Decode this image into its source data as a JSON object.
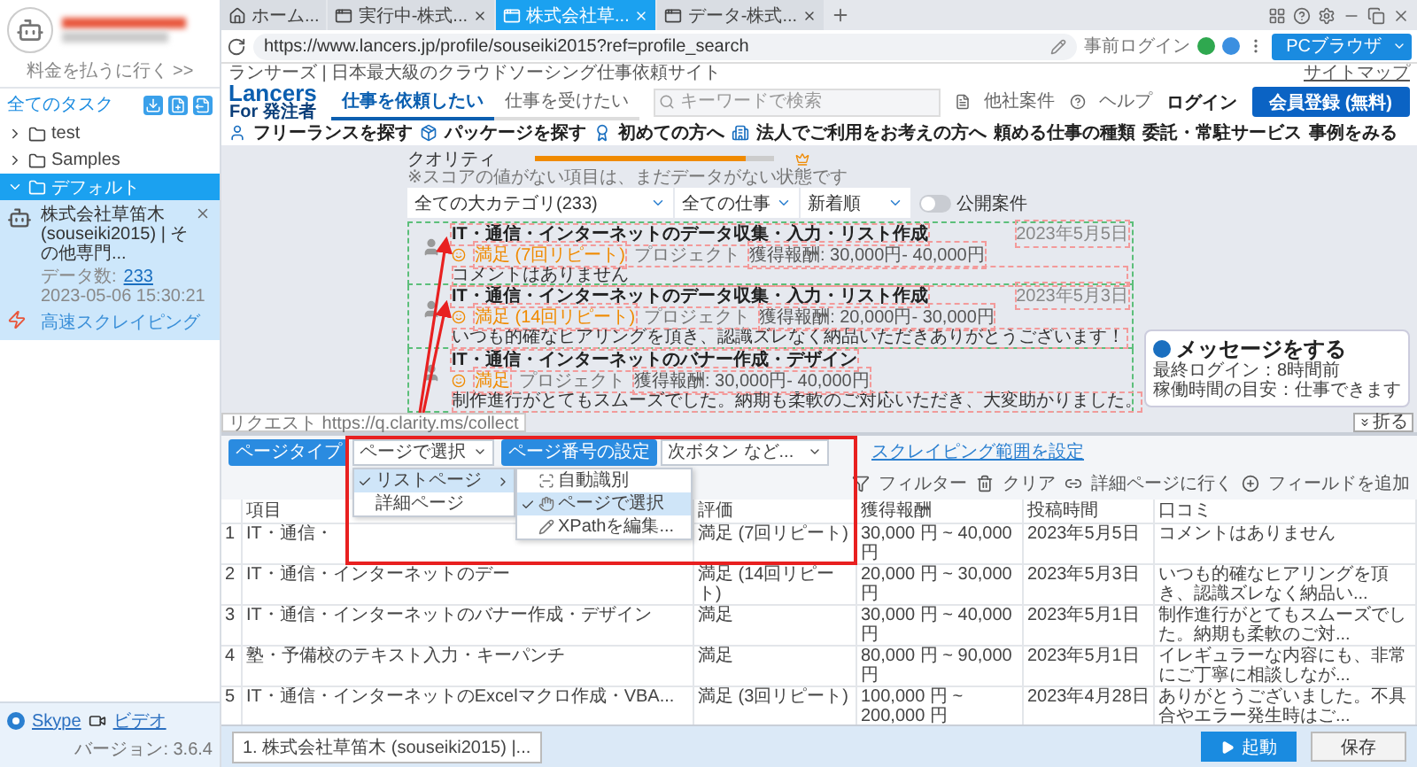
{
  "sidebar": {
    "account_link": "料金を払うに行く >>",
    "header": "全てのタスク",
    "folders": [
      {
        "label": "test",
        "expanded": false,
        "selected": false
      },
      {
        "label": "Samples",
        "expanded": false,
        "selected": false
      },
      {
        "label": "デフォルト",
        "expanded": true,
        "selected": true,
        "tasks": [
          {
            "title": "株式会社草笛木 (souseiki2015) | その他専門...",
            "data_label": "データ数:",
            "count": "233",
            "time": "2023-05-06 15:30:21",
            "mode": "高速スクレイピング"
          }
        ]
      }
    ],
    "footer": {
      "links": [
        "Skype",
        "ビデオ"
      ],
      "version": "バージョン: 3.6.4"
    }
  },
  "browser": {
    "tabs": [
      {
        "label": "ホーム...",
        "selected": false,
        "kind": "home"
      },
      {
        "label": "実行中-株式...",
        "selected": false,
        "kind": "page"
      },
      {
        "label": "株式会社草...",
        "selected": true,
        "kind": "page"
      },
      {
        "label": "データ-株式...",
        "selected": false,
        "kind": "page"
      }
    ],
    "url": "https://www.lancers.jp/profile/souseiki2015?ref=profile_search",
    "login": "事前ログイン",
    "mode_button": "PCブラウザ"
  },
  "page": {
    "tagline": "ランサーズ | 日本最大級のクラウドソーシング仕事依頼サイト",
    "sitemap": "サイトマップ",
    "logo": "Lancers",
    "logo_sub": "For 発注者",
    "tabs": [
      {
        "label": "仕事を依頼したい",
        "selected": true
      },
      {
        "label": "仕事を受けたい",
        "selected": false
      }
    ],
    "search": {
      "placeholder": "キーワードで検索"
    },
    "icon_links": [
      "他社案件",
      "ヘルプ"
    ],
    "login": "ログイン",
    "signup": "会員登録 (無料)",
    "nav": [
      "フリーランスを探す",
      "パッケージを探す",
      "初めての方へ",
      "法人でご利用をお考えの方へ",
      "頼める仕事の種類",
      "委託・常駐サービス",
      "事例をみる"
    ],
    "quality": {
      "label": "クオリティ",
      "level": 0.88
    },
    "note": "※スコアの値がない項目は、まだデータがない状態です",
    "filters": [
      "全ての大カテゴリ(233)",
      "全ての仕事",
      "新着順"
    ],
    "public_toggle": {
      "label": "公開案件",
      "on": false
    },
    "cards": [
      {
        "title": "IT・通信・インターネットのデータ収集・入力・リスト作成",
        "date": "2023年5月5日",
        "rating": "満足 (7回リピート)",
        "type": "プロジェクト",
        "reward": "獲得報酬: 30,000円- 40,000円",
        "comment": "コメントはありません"
      },
      {
        "title": "IT・通信・インターネットのデータ収集・入力・リスト作成",
        "date": "2023年5月3日",
        "rating": "満足 (14回リピート)",
        "type": "プロジェクト",
        "reward": "獲得報酬: 20,000円- 30,000円",
        "comment": "いつも的確なヒアリングを頂き、認識ズレなく納品いただきありがとうございます！"
      },
      {
        "title": "IT・通信・インターネットのバナー作成・デザイン",
        "rating": "満足",
        "type": "プロジェクト",
        "reward": "獲得報酬: 30,000円- 40,000円",
        "comment": "制作進行がとてもスムーズでした。納期も柔軟のご対応いただき、大変助かりました。"
      }
    ],
    "request_tip": "リクエスト https://q.clarity.ms/collect",
    "message": {
      "title": "メッセージをする",
      "lines": [
        "最終ログイン：8時間前",
        "稼働時間の目安：仕事できます"
      ]
    },
    "collapse": "折る"
  },
  "panel": {
    "page_type_label": "ページタイプ",
    "page_type": "ページで選択",
    "page_number_label": "ページ番号の設定",
    "page_number": "次ボタン など...",
    "range_link": "スクレイピング範囲を設定",
    "actions": [
      "フィルター",
      "クリア",
      "詳細ページに行く",
      "フィールドを追加"
    ],
    "menu": [
      {
        "label": "リストページ",
        "checked": true,
        "selected": true,
        "has_submenu": true
      },
      {
        "label": "詳細ページ",
        "checked": false,
        "selected": false,
        "has_submenu": false
      }
    ],
    "submenu": [
      {
        "label": "自動識別",
        "kind": "auto",
        "checked": false,
        "selected": false
      },
      {
        "label": "ページで選択",
        "kind": "hand",
        "checked": true,
        "selected": true
      },
      {
        "label": "XPathを編集...",
        "kind": "edit",
        "checked": false,
        "selected": false
      }
    ],
    "table": {
      "columns": [
        "項目",
        "評価",
        "獲得報酬",
        "投稿時間",
        "口コミ"
      ],
      "rows": [
        {
          "index": "1",
          "cells": [
            "IT・通信・",
            "満足 (7回リピート)",
            "30,000 円 ~ 40,000 円",
            "2023年5月5日",
            "コメントはありません"
          ]
        },
        {
          "index": "2",
          "cells": [
            "IT・通信・インターネットのデー",
            "満足 (14回リピート)",
            "20,000 円 ~ 30,000 円",
            "2023年5月3日",
            "いつも的確なヒアリングを頂き、認識ズレなく納品い..."
          ]
        },
        {
          "index": "3",
          "cells": [
            "IT・通信・インターネットのバナー作成・デザイン",
            "満足",
            "30,000 円 ~ 40,000 円",
            "2023年5月1日",
            "制作進行がとてもスムーズでした。納期も柔軟のご対..."
          ]
        },
        {
          "index": "4",
          "cells": [
            "塾・予備校のテキスト入力・キーパンチ",
            "満足",
            "80,000 円 ~ 90,000 円",
            "2023年5月1日",
            "イレギュラーな内容にも、非常にご丁寧に相談しなが..."
          ]
        },
        {
          "index": "5",
          "cells": [
            "IT・通信・インターネットのExcelマクロ作成・VBA...",
            "満足 (3回リピート)",
            "100,000 円 ~ 200,000 円",
            "2023年4月28日",
            "ありがとうございました。不具合やエラー発生時はご..."
          ]
        }
      ]
    }
  },
  "run_tabs": [
    "1. 株式会社草笛木 (souseiki2015) |..."
  ],
  "buttons": {
    "run": "起動",
    "save": "保存"
  }
}
